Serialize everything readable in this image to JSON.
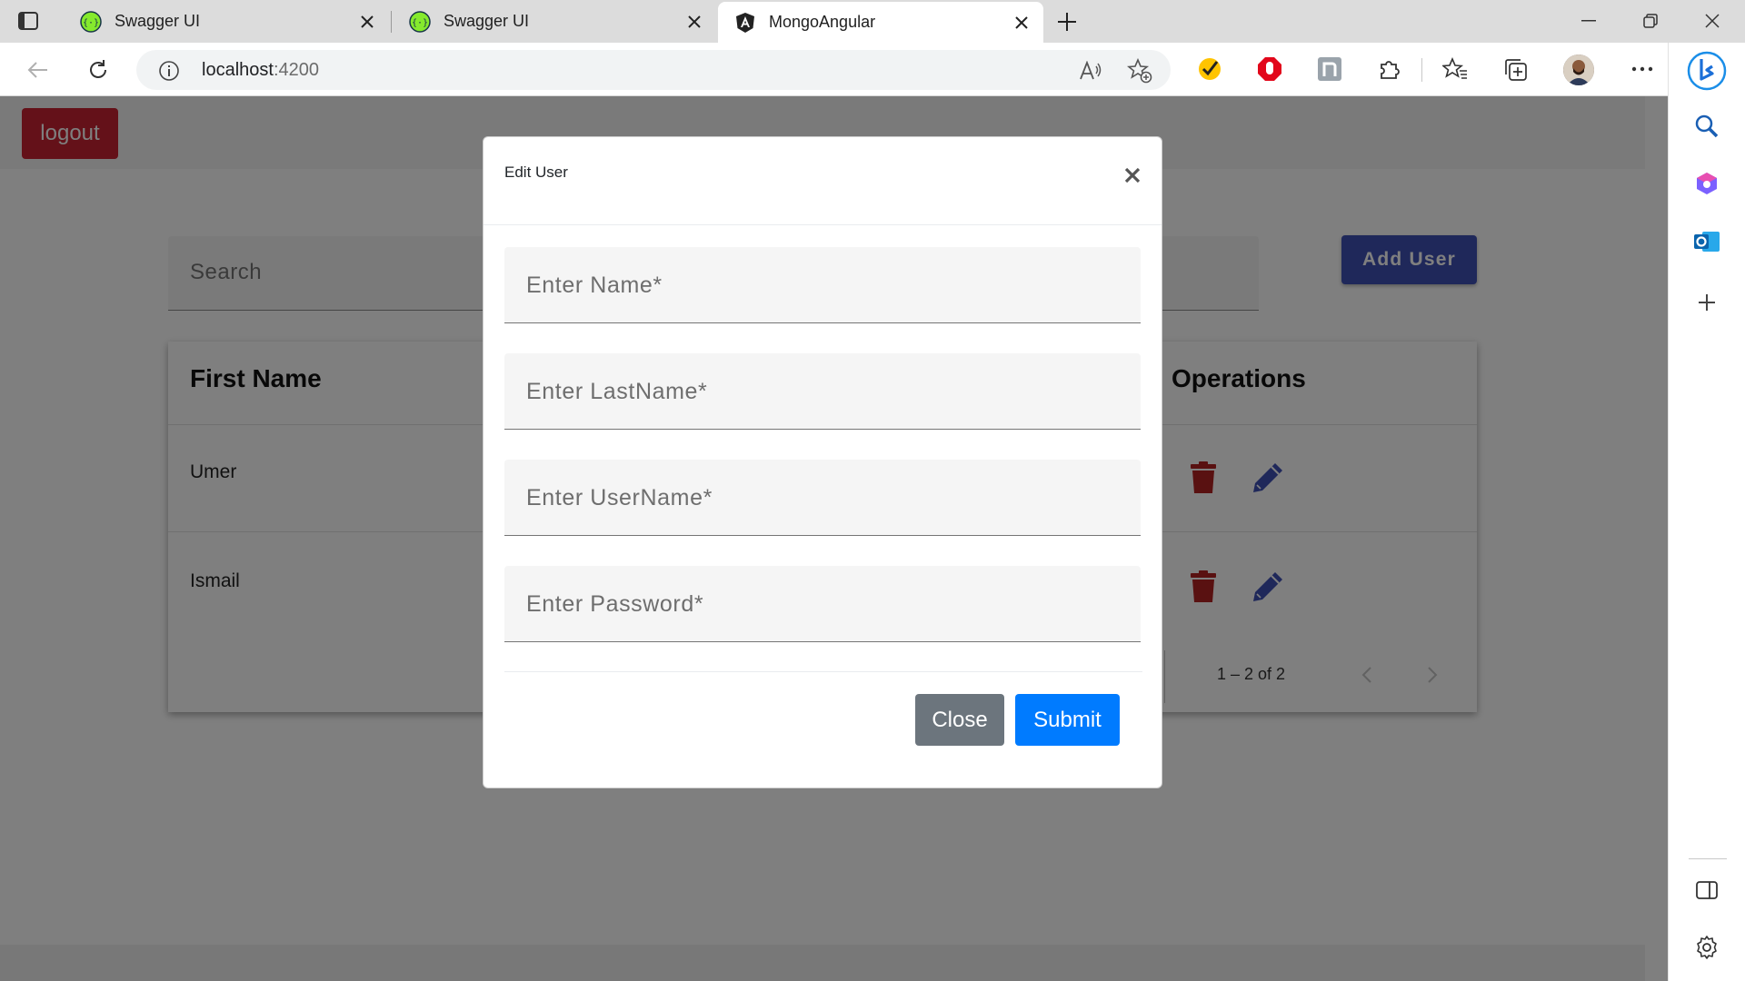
{
  "browser": {
    "tabs": [
      {
        "title": "Swagger UI",
        "icon": "swagger-icon",
        "active": false
      },
      {
        "title": "Swagger UI",
        "icon": "swagger-icon",
        "active": false
      },
      {
        "title": "MongoAngular",
        "icon": "angular-icon",
        "active": true
      }
    ],
    "url_host": "localhost",
    "url_port": ":4200"
  },
  "app": {
    "logout_label": "logout",
    "search_placeholder": "Search",
    "add_user_label": "Add User",
    "table": {
      "columns": [
        "First Name",
        "Operations"
      ],
      "rows": [
        {
          "first_name": "Umer"
        },
        {
          "first_name": "Ismail"
        }
      ],
      "paginator_range": "1 – 2 of 2"
    }
  },
  "modal": {
    "title": "Edit User",
    "fields": [
      {
        "placeholder": "Enter Name*",
        "value": ""
      },
      {
        "placeholder": "Enter LastName*",
        "value": ""
      },
      {
        "placeholder": "Enter UserName*",
        "value": ""
      },
      {
        "placeholder": "Enter Password*",
        "value": ""
      }
    ],
    "close_label": "Close",
    "submit_label": "Submit"
  },
  "colors": {
    "logout": "#c82333",
    "add_user": "#3f51b5",
    "delete_icon": "#b22222",
    "edit_icon": "#3f51b5",
    "close_button": "#6c757d",
    "submit_button": "#007bff"
  }
}
